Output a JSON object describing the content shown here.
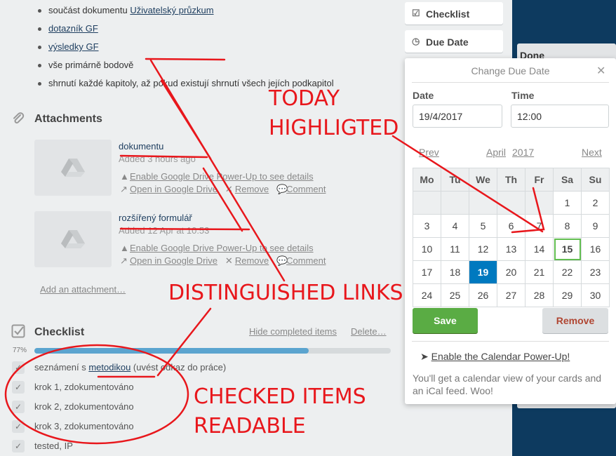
{
  "description_list": [
    {
      "prefix": "součást dokumentu ",
      "link": "Uživatelský průzkum"
    },
    {
      "prefix": "",
      "link": "dotazník GF"
    },
    {
      "prefix": "",
      "link": "výsledky GF"
    },
    {
      "prefix": "vše primárně bodově",
      "link": ""
    },
    {
      "prefix": "shrnutí každé kapitoly, až pokud existují shrnutí všech jejích podkapitol",
      "link": ""
    }
  ],
  "attachments": {
    "title": "Attachments",
    "items": [
      {
        "name": "dokumentu",
        "meta": "Added 3 hours ago",
        "enable": "Enable Google Drive Power-Up to see details",
        "open": "Open in Google Drive",
        "remove": "Remove",
        "comment": "Comment"
      },
      {
        "name": "rozšířený formulář",
        "meta": "Added 12 Apr at 10:53",
        "enable": "Enable Google Drive Power-Up to see details",
        "open": "Open in Google Drive",
        "remove": "Remove",
        "comment": "Comment"
      }
    ],
    "add_label": "Add an attachment…"
  },
  "checklist": {
    "title": "Checklist",
    "hide_label": "Hide completed items",
    "delete_label": "Delete…",
    "progress_label": "77%",
    "progress": 0.77,
    "items": [
      {
        "prefix": "seznámení s ",
        "link": "metodikou",
        "suffix": " (uvést odkaz do práce)"
      },
      {
        "prefix": "krok 1, zdokumentováno",
        "link": "",
        "suffix": ""
      },
      {
        "prefix": "krok 2, zdokumentováno",
        "link": "",
        "suffix": ""
      },
      {
        "prefix": "krok 3, zdokumentováno",
        "link": "",
        "suffix": ""
      },
      {
        "prefix": "tested, IP",
        "link": "",
        "suffix": ""
      }
    ]
  },
  "sidebar": {
    "checklist_label": "Checklist",
    "due_date_label": "Due Date"
  },
  "board": {
    "list_title": "Done"
  },
  "due_date_popover": {
    "title": "Change Due Date",
    "date_label": "Date",
    "date_value": "19/4/2017",
    "time_label": "Time",
    "time_value": "12:00",
    "prev_label": "Prev",
    "month_label": "April",
    "year_label": "2017",
    "next_label": "Next",
    "weekdays": [
      "Mo",
      "Tu",
      "We",
      "Th",
      "Fr",
      "Sa",
      "Su"
    ],
    "weeks": [
      [
        "",
        "",
        "",
        "",
        "",
        "1",
        "2"
      ],
      [
        "3",
        "4",
        "5",
        "6",
        "7",
        "8",
        "9"
      ],
      [
        "10",
        "11",
        "12",
        "13",
        "14",
        "15",
        "16"
      ],
      [
        "17",
        "18",
        "19",
        "20",
        "21",
        "22",
        "23"
      ],
      [
        "24",
        "25",
        "26",
        "27",
        "28",
        "29",
        "30"
      ]
    ],
    "today": "15",
    "selected": "19",
    "save_label": "Save",
    "remove_label": "Remove",
    "powerup_link": "Enable the Calendar Power-Up!",
    "powerup_desc": "You'll get a calendar view of your cards and an iCal feed. Woo!"
  },
  "annotations": {
    "today_line1": "TODAY",
    "today_line2": "HIGHLIGTED",
    "links": "DISTINGUISHED LINKS",
    "checked_line1": "CHECKED ITEMS",
    "checked_line2": "READABLE",
    "color": "#e8171c"
  },
  "colors": {
    "link_blue": "#1f3f60",
    "save_green": "#5aac44",
    "selected_blue": "#0079bf",
    "today_green": "#61bd4f",
    "board_bg": "#0d3a5f"
  }
}
